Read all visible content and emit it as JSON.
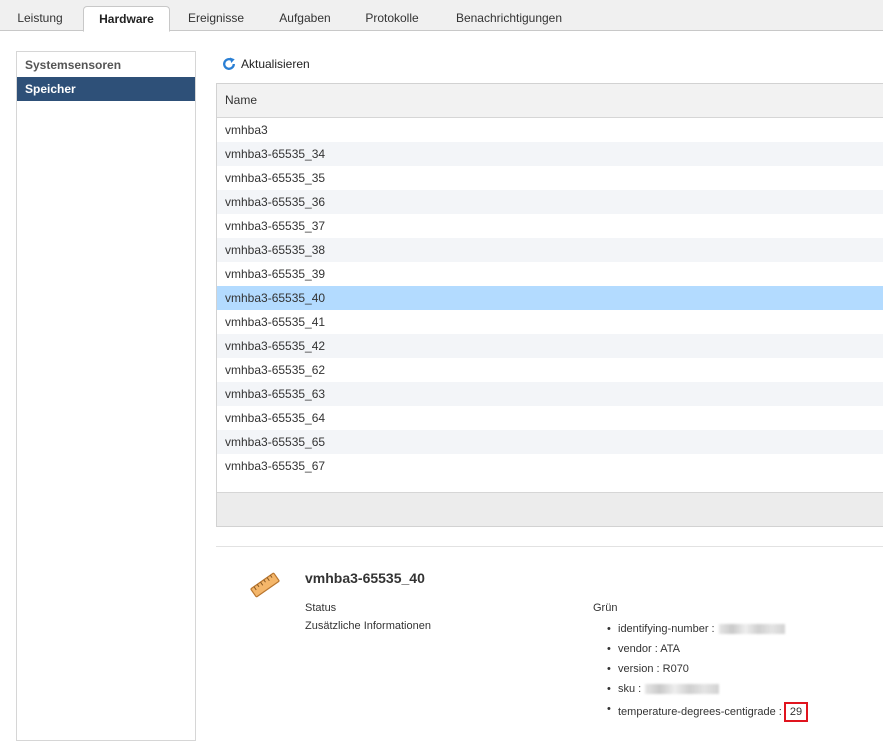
{
  "tabs": [
    {
      "label": "Leistung"
    },
    {
      "label": "Hardware"
    },
    {
      "label": "Ereignisse"
    },
    {
      "label": "Aufgaben"
    },
    {
      "label": "Protokolle"
    },
    {
      "label": "Benachrichtigungen"
    }
  ],
  "sidebar": {
    "items": [
      {
        "label": "Systemsensoren"
      },
      {
        "label": "Speicher"
      }
    ]
  },
  "toolbar": {
    "refresh_label": "Aktualisieren"
  },
  "table": {
    "header": "Name",
    "rows": [
      "vmhba3",
      "vmhba3-65535_34",
      "vmhba3-65535_35",
      "vmhba3-65535_36",
      "vmhba3-65535_37",
      "vmhba3-65535_38",
      "vmhba3-65535_39",
      "vmhba3-65535_40",
      "vmhba3-65535_41",
      "vmhba3-65535_42",
      "vmhba3-65535_62",
      "vmhba3-65535_63",
      "vmhba3-65535_64",
      "vmhba3-65535_65",
      "vmhba3-65535_67"
    ]
  },
  "details": {
    "title": "vmhba3-65535_40",
    "status_label": "Status",
    "status_value": "Grün",
    "info_label": "Zusätzliche Informationen",
    "info": {
      "identifying": "identifying-number :",
      "vendor": "vendor : ATA",
      "version": "version : R070",
      "sku": "sku :",
      "temp_label": "temperature-degrees-centigrade :",
      "temp_value": "29"
    }
  },
  "colors": {
    "selected_row": "#b3dbff",
    "active_nav": "#2e5078",
    "highlight_box": "#e0141e"
  }
}
